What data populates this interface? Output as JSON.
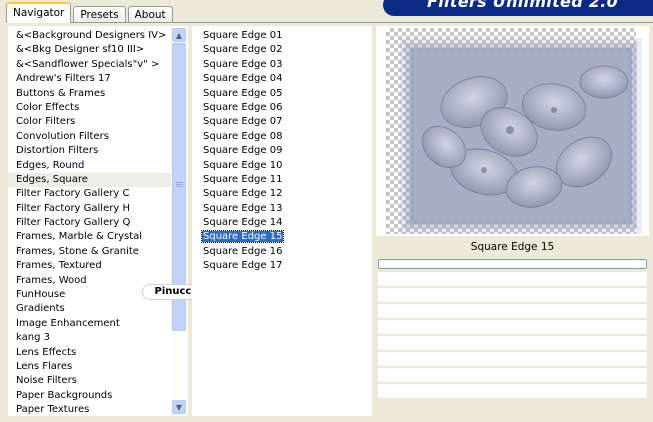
{
  "tabs": [
    {
      "label": "Navigator",
      "active": true
    },
    {
      "label": "Presets",
      "active": false
    },
    {
      "label": "About",
      "active": false
    }
  ],
  "banner": {
    "title": "Filters Unlimited 2.0",
    "color": "#0A2A86"
  },
  "categories": [
    "&<Background Designers IV>",
    "&<Bkg Designer sf10 III>",
    "&<Sandflower Specials\"v\" >",
    "Andrew's Filters 17",
    "Buttons & Frames",
    "Color Effects",
    "Color Filters",
    "Convolution Filters",
    "Distortion Filters",
    "Edges, Round",
    "Edges, Square",
    "Filter Factory Gallery C",
    "Filter Factory Gallery H",
    "Filter Factory Gallery Q",
    "Frames, Marble & Crystal",
    "Frames, Stone & Granite",
    "Frames, Textured",
    "Frames, Wood",
    "FunHouse",
    "Gradients",
    "Image Enhancement",
    "kang 3",
    "Lens Effects",
    "Lens Flares",
    "Noise Filters",
    "Paper Backgrounds",
    "Paper Textures"
  ],
  "selected_category": "Edges, Square",
  "filters": [
    "Square Edge 01",
    "Square Edge 02",
    "Square Edge 03",
    "Square Edge 04",
    "Square Edge 05",
    "Square Edge 06",
    "Square Edge 07",
    "Square Edge 08",
    "Square Edge 09",
    "Square Edge 10",
    "Square Edge 11",
    "Square Edge 12",
    "Square Edge 13",
    "Square Edge 14",
    "Square Edge 15",
    "Square Edge 16",
    "Square Edge 17"
  ],
  "selected_filter": "Square Edge 15",
  "preview": {
    "caption": "Square Edge 15"
  },
  "watermark": "Pinuccia",
  "scrollbar": {
    "up_icon": "up-arrow-icon",
    "down_icon": "down-arrow-icon"
  },
  "colors": {
    "selection": "#316AC5",
    "window_bg": "#ECE9D8",
    "tab_highlight": "#FFC83C"
  }
}
